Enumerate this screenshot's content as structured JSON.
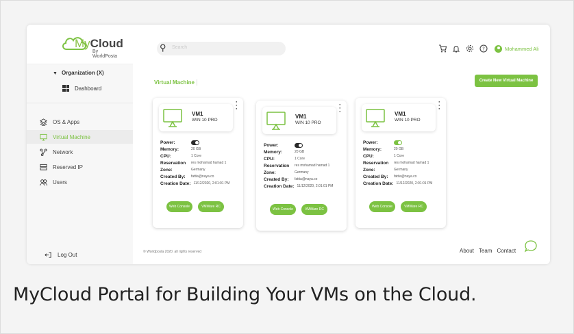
{
  "logo": {
    "my": "My",
    "cloud": "Cloud",
    "by": "By WorldPosta"
  },
  "search": {
    "placeholder": "Search"
  },
  "user": {
    "name": "Mohammed Ali"
  },
  "sidebar": {
    "org": "Organization (X)",
    "dashboard": "Dashboard",
    "items": [
      {
        "label": "OS & Apps",
        "icon": "layers-icon"
      },
      {
        "label": "Virtual Machine",
        "icon": "monitor-icon",
        "active": true
      },
      {
        "label": "Network",
        "icon": "network-icon"
      },
      {
        "label": "Reserved IP",
        "icon": "server-icon"
      },
      {
        "label": "Users",
        "icon": "users-icon"
      }
    ],
    "logout": "Log Out"
  },
  "main": {
    "breadcrumb": "Virtual Machine",
    "create_button": "Create New Virtual Machine"
  },
  "labels": {
    "power": "Power:",
    "memory": "Memory:",
    "cpu": "CPU:",
    "reservation": "Reservation",
    "zone": "Zone:",
    "created_by": "Created By:",
    "creation_date": "Creation Date:",
    "web_console": "Web Console",
    "vmware_rc": "VMWare RC"
  },
  "vms": [
    {
      "name": "VM1",
      "os": "WIN 10 PRO",
      "power_on": false,
      "memory": "20 GB",
      "cpu": "1 Core",
      "reservation": "res mohamad hamad 1",
      "zone": "Germany",
      "created_by": "fattia@naya.co",
      "creation_date": "11/12/2020, 2:01:01 PM"
    },
    {
      "name": "VM1",
      "os": "WIN 10 PRO",
      "power_on": false,
      "memory": "20 GB",
      "cpu": "1 Core",
      "reservation": "res mohamad hamad 1",
      "zone": "Germany",
      "created_by": "fattia@naya.co",
      "creation_date": "11/12/2020, 2:01:01 PM"
    },
    {
      "name": "VM1",
      "os": "WIN 10 PRO",
      "power_on": true,
      "memory": "20 GB",
      "cpu": "1 Core",
      "reservation": "res mohamad hamad 1",
      "zone": "Germany",
      "created_by": "fattia@naya.co",
      "creation_date": "11/12/2020, 2:01:01 PM"
    }
  ],
  "footer": {
    "copyright": "© Worldposta 2020. all rights reserved",
    "links": [
      "About",
      "Team",
      "Contact"
    ]
  },
  "caption": "MyCloud Portal for Building Your VMs on the Cloud.",
  "colors": {
    "accent": "#7cc242"
  }
}
